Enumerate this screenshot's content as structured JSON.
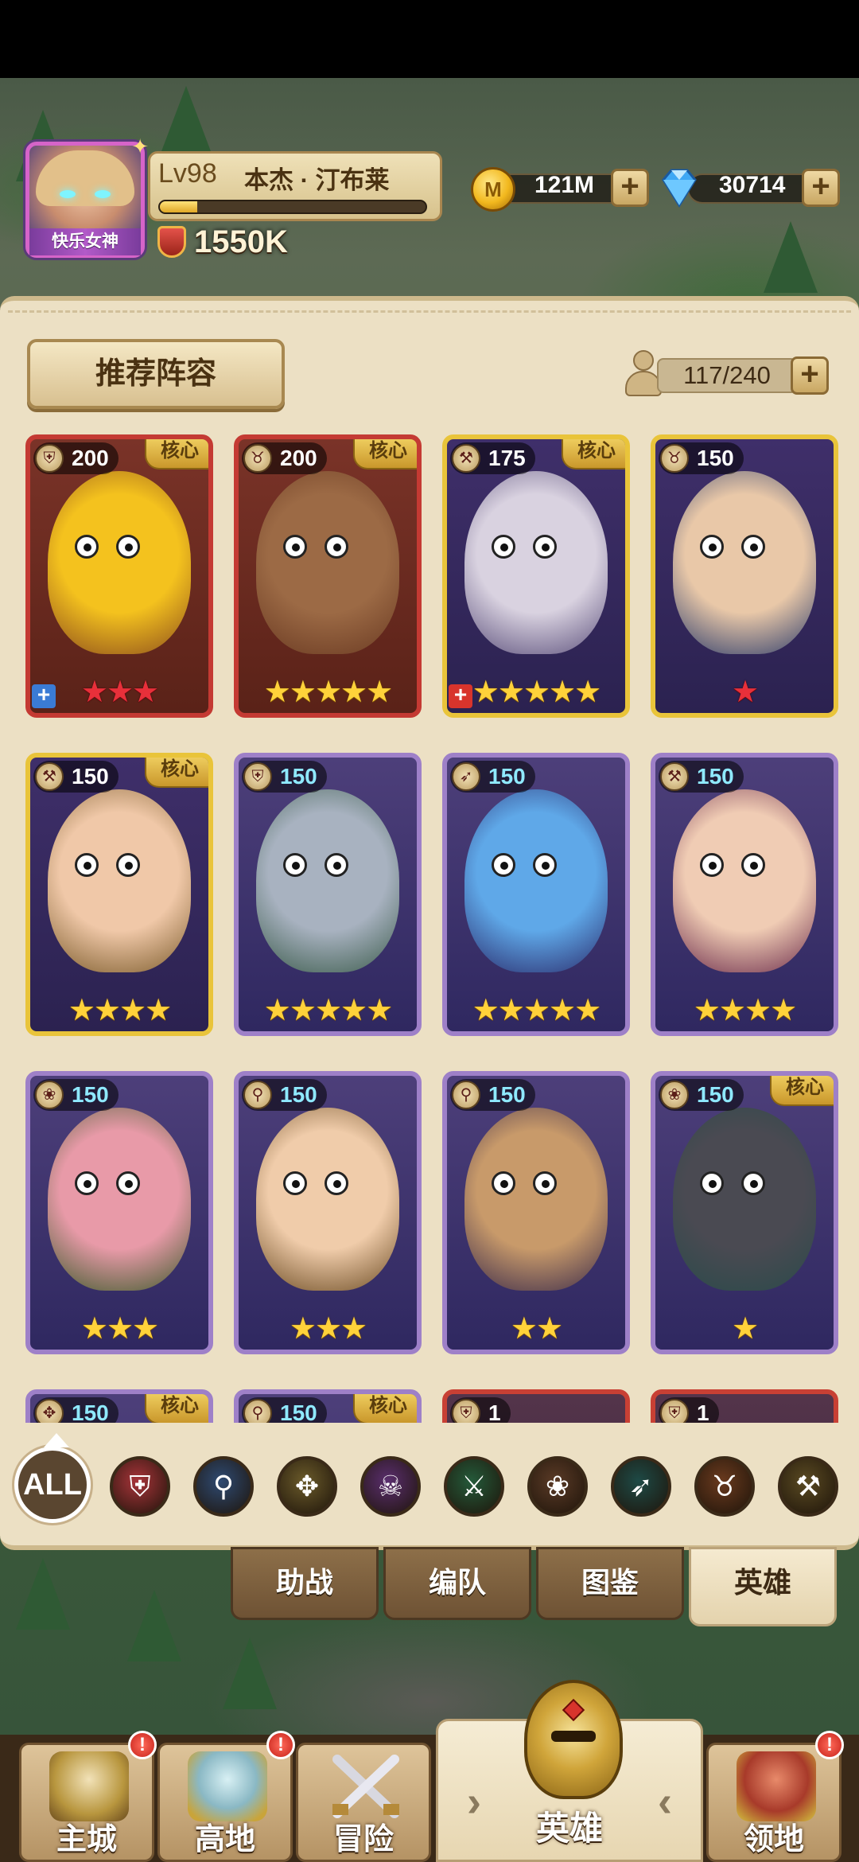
{
  "player": {
    "title": "快乐女神",
    "level": "Lv98",
    "name": "本杰 · 汀布莱",
    "exp_fraction": 0.14,
    "power": "1550K"
  },
  "currency": {
    "gold": "121M",
    "gems": "30714"
  },
  "panel": {
    "recommend_label": "推荐阵容",
    "capacity": "117/240"
  },
  "heroes": [
    {
      "value": "200",
      "core": "核心",
      "stars": 3,
      "star_color": "red",
      "rarity": "red",
      "class_icon": "shield-icon",
      "plus": "+",
      "plus_color": "#3a7bd5",
      "colors": [
        "#f4c21e",
        "#8a4b1c"
      ]
    },
    {
      "value": "200",
      "core": "核心",
      "stars": 5,
      "star_color": "gold",
      "rarity": "red",
      "class_icon": "bull-icon",
      "plus": "",
      "plus_color": "",
      "colors": [
        "#9c6a45",
        "#6a3a22"
      ]
    },
    {
      "value": "175",
      "core": "核心",
      "stars": 5,
      "star_color": "gold",
      "rarity": "gold",
      "class_icon": "hammer-icon",
      "plus": "+",
      "plus_color": "#d8342c",
      "colors": [
        "#d9d2e0",
        "#5a4e7a"
      ]
    },
    {
      "value": "150",
      "core": "",
      "stars": 1,
      "star_color": "red",
      "rarity": "gold",
      "class_icon": "bull-icon",
      "plus": "",
      "plus_color": "",
      "colors": [
        "#e9c8a8",
        "#2a3a6a"
      ]
    },
    {
      "value": "150",
      "core": "核心",
      "stars": 4,
      "star_color": "gold",
      "rarity": "gold",
      "class_icon": "hammer-icon",
      "plus": "",
      "plus_color": "",
      "colors": [
        "#f0c8a8",
        "#7a5a2a"
      ]
    },
    {
      "value": "150",
      "core": "",
      "stars": 5,
      "star_color": "gold",
      "rarity": "purple",
      "class_icon": "shield-icon",
      "plus": "",
      "plus_color": "",
      "colors": [
        "#a8b2c0",
        "#3a5a4a"
      ]
    },
    {
      "value": "150",
      "core": "",
      "stars": 5,
      "star_color": "gold",
      "rarity": "purple",
      "class_icon": "bow-icon",
      "plus": "",
      "plus_color": "",
      "colors": [
        "#5fa8e8",
        "#2a2a6a"
      ]
    },
    {
      "value": "150",
      "core": "",
      "stars": 4,
      "star_color": "gold",
      "rarity": "purple",
      "class_icon": "hammer-icon",
      "plus": "",
      "plus_color": "",
      "colors": [
        "#f0ccb4",
        "#6a2a4a"
      ]
    },
    {
      "value": "150",
      "core": "",
      "stars": 3,
      "star_color": "gold",
      "rarity": "purple",
      "class_icon": "paw-icon",
      "plus": "",
      "plus_color": "",
      "colors": [
        "#e89aa8",
        "#3a5a2a"
      ]
    },
    {
      "value": "150",
      "core": "",
      "stars": 3,
      "star_color": "gold",
      "rarity": "purple",
      "class_icon": "staff-icon",
      "plus": "",
      "plus_color": "",
      "colors": [
        "#f0ccaa",
        "#6a4a22"
      ]
    },
    {
      "value": "150",
      "core": "",
      "stars": 2,
      "star_color": "gold",
      "rarity": "purple",
      "class_icon": "staff-icon",
      "plus": "",
      "plus_color": "",
      "colors": [
        "#c89a6a",
        "#3a2a4a"
      ]
    },
    {
      "value": "150",
      "core": "核心",
      "stars": 1,
      "star_color": "gold",
      "rarity": "purple",
      "class_icon": "paw-icon",
      "plus": "",
      "plus_color": "",
      "colors": [
        "#4a4a52",
        "#2a4a4a"
      ]
    },
    {
      "value": "150",
      "core": "核心",
      "stars": 0,
      "star_color": "gold",
      "rarity": "purple",
      "class_icon": "eagle-icon",
      "plus": "",
      "plus_color": "",
      "colors": [
        "#6a5aa0",
        "#3a3a6a"
      ]
    },
    {
      "value": "150",
      "core": "核心",
      "stars": 0,
      "star_color": "gold",
      "rarity": "purple",
      "class_icon": "staff-icon",
      "plus": "",
      "plus_color": "",
      "colors": [
        "#3a9a9a",
        "#2a4a5a"
      ]
    },
    {
      "value": "1",
      "core": "",
      "stars": 0,
      "star_color": "gold",
      "rarity": "red2",
      "class_icon": "shield-icon",
      "plus": "",
      "plus_color": "",
      "colors": [
        "#6a4a3a",
        "#3a2a22"
      ]
    },
    {
      "value": "1",
      "core": "",
      "stars": 0,
      "star_color": "gold",
      "rarity": "red2",
      "class_icon": "shield-icon",
      "plus": "",
      "plus_color": "",
      "colors": [
        "#2a2a52",
        "#1a1a3a"
      ]
    }
  ],
  "filters": {
    "all_label": "ALL",
    "icons": [
      {
        "name": "shield-filter-icon",
        "glyph": "⛨",
        "bg": "#a8343a"
      },
      {
        "name": "staff-filter-icon",
        "glyph": "⚲",
        "bg": "#2e4a72"
      },
      {
        "name": "eagle-filter-icon",
        "glyph": "✥",
        "bg": "#6a5a2a"
      },
      {
        "name": "skull-filter-icon",
        "glyph": "☠",
        "bg": "#5a2e6e"
      },
      {
        "name": "crossed-swords-filter-icon",
        "glyph": "⚔",
        "bg": "#245a3a"
      },
      {
        "name": "paw-filter-icon",
        "glyph": "❀",
        "bg": "#5a3a26"
      },
      {
        "name": "bow-filter-icon",
        "glyph": "➶",
        "bg": "#1e4a46"
      },
      {
        "name": "bull-filter-icon",
        "glyph": "♉",
        "bg": "#6a3a1e"
      },
      {
        "name": "hammer-filter-icon",
        "glyph": "⚒",
        "bg": "#5a4a22"
      }
    ]
  },
  "subtabs": [
    "助战",
    "编队",
    "图鉴",
    "英雄"
  ],
  "nav": {
    "items": [
      "主城",
      "高地",
      "冒险",
      "英雄",
      "领地"
    ],
    "alert": "!"
  }
}
